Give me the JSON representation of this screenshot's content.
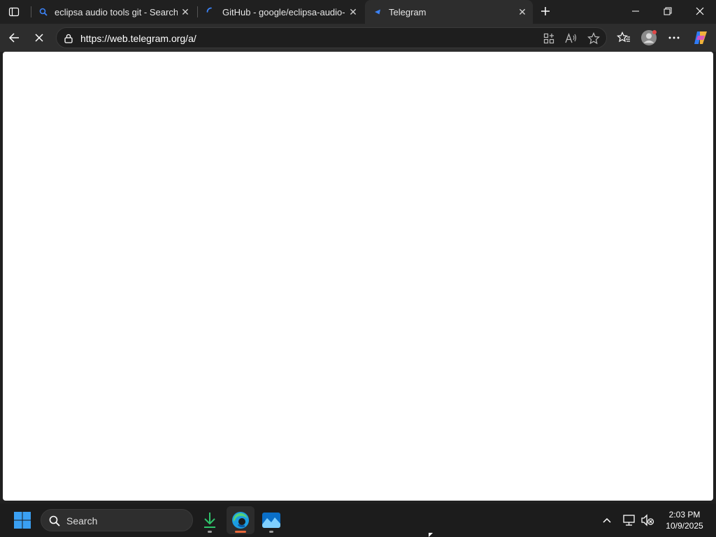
{
  "browser": {
    "tabs": [
      {
        "title": "eclipsa audio tools git - Search",
        "favicon": "search-icon"
      },
      {
        "title": "GitHub - google/eclipsa-audio-plugin",
        "favicon": "loading-icon"
      },
      {
        "title": "Telegram",
        "favicon": "telegram-icon",
        "active": true
      }
    ],
    "address": {
      "url": "https://web.telegram.org/a/"
    }
  },
  "taskbar": {
    "search_label": "Search",
    "time": "2:03 PM",
    "date": "10/9/2025"
  },
  "colors": {
    "accent_edge": "#e8673a",
    "download_green": "#2fc46b",
    "search_blue": "#1a73e8"
  }
}
